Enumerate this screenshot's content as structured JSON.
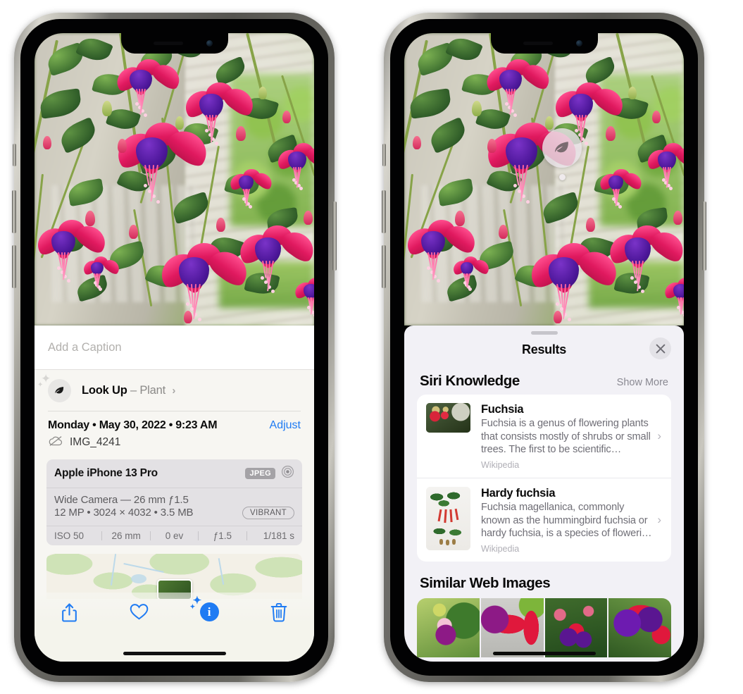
{
  "left_phone": {
    "caption_field": {
      "placeholder": "Add a Caption",
      "value": ""
    },
    "lookup": {
      "label": "Look Up",
      "dash": "–",
      "subject": "Plant",
      "chevron": "›",
      "icon": "leaf-icon"
    },
    "date_line": "Monday • May 30, 2022 • 9:23 AM",
    "adjust_label": "Adjust",
    "file_name": "IMG_4241",
    "cloud_icon": "cloud-slash-icon",
    "camera_card": {
      "device": "Apple iPhone 13 Pro",
      "format_badge": "JPEG",
      "lens_icon": "aperture-icon",
      "lens_line": "Wide Camera — 26 mm ƒ1.5",
      "detail_line": "12 MP • 3024 × 4032 • 3.5 MB",
      "style_badge": "VIBRANT",
      "exif": [
        "ISO 50",
        "26 mm",
        "0 ev",
        "ƒ1.5",
        "1/181 s"
      ]
    },
    "toolbar": [
      {
        "name": "share-button",
        "icon": "share-icon"
      },
      {
        "name": "favorite-button",
        "icon": "heart-icon"
      },
      {
        "name": "info-button",
        "icon": "info-sparkle-icon",
        "active": true
      },
      {
        "name": "delete-button",
        "icon": "trash-icon"
      }
    ]
  },
  "right_phone": {
    "vlu_badge": {
      "icon": "leaf-icon"
    },
    "sheet": {
      "title": "Results",
      "close_icon": "close-icon",
      "siri_knowledge": {
        "title": "Siri Knowledge",
        "show_more": "Show More",
        "items": [
          {
            "title": "Fuchsia",
            "description": "Fuchsia is a genus of flowering plants that consists mostly of shrubs or small trees. The first to be scientific…",
            "source": "Wikipedia",
            "chevron": "›"
          },
          {
            "title": "Hardy fuchsia",
            "description": "Fuchsia magellanica, commonly known as the hummingbird fuchsia or hardy fuchsia, is a species of floweri…",
            "source": "Wikipedia",
            "chevron": "›"
          }
        ]
      },
      "similar_web_images": {
        "title": "Similar Web Images",
        "count": 4
      }
    }
  },
  "colors": {
    "accent_blue": "#1f7bf3",
    "sheet_bg": "#f2f1f6",
    "info_bg": "#f7f6f2",
    "card_bg": "#e3e1e4",
    "flower_pink": "#e0195f",
    "flower_purple": "#4d179a"
  }
}
